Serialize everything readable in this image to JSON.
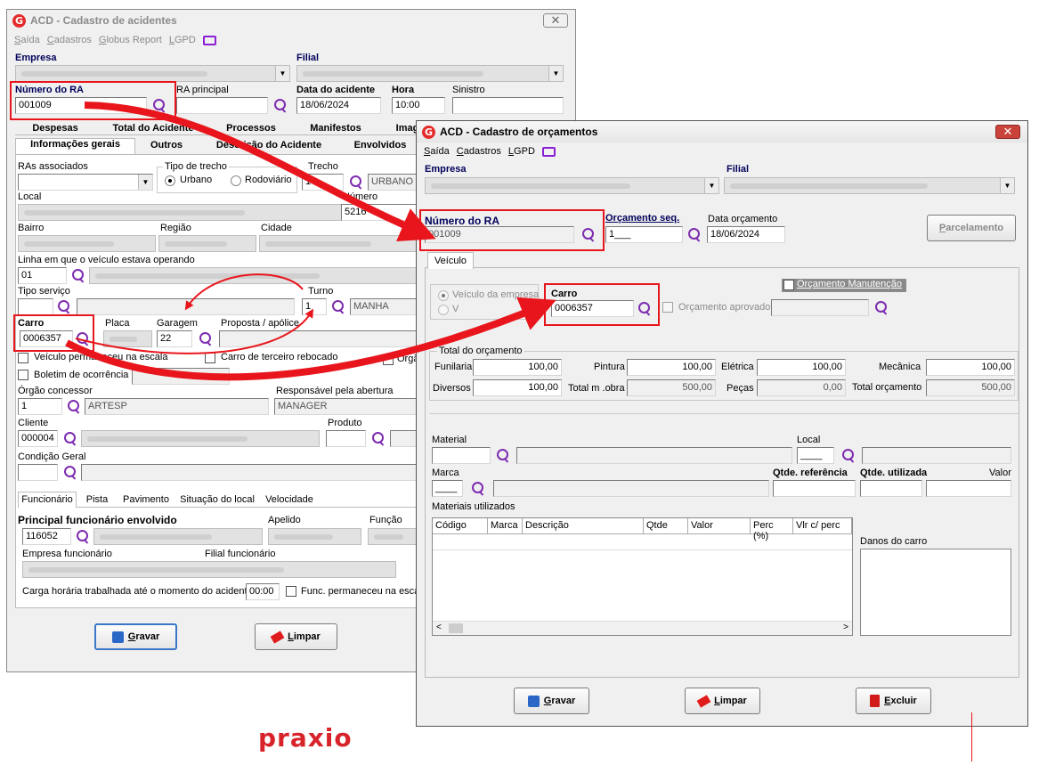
{
  "win1": {
    "title": "ACD - Cadastro de acidentes",
    "close": "✕",
    "menu": [
      "Saída",
      "Cadastros",
      "Globus Report",
      "LGPD"
    ],
    "empresa_label": "Empresa",
    "filial_label": "Filial",
    "numero_ra_label": "Número do RA",
    "numero_ra_value": "001009",
    "ra_principal_label": "RA principal",
    "data_acidente_label": "Data do acidente",
    "data_acidente_value": "18/06/2024",
    "hora_label": "Hora",
    "hora_value": "10:00",
    "sinistro_label": "Sinistro",
    "tabs_row1": [
      "Despesas",
      "Total do Acidente",
      "Processos",
      "Manifestos",
      "Imagens"
    ],
    "tabs_row2": [
      "Informações gerais",
      "Outros",
      "Descrição do Acidente",
      "Envolvidos"
    ],
    "ras_associados_label": "RAs associados",
    "tipo_trecho_label": "Tipo de trecho",
    "urbano": "Urbano",
    "rodoviario": "Rodoviário",
    "trecho_label": "Trecho",
    "trecho_value": "1",
    "trecho_desc": "URBANO",
    "local_label": "Local",
    "numero_label": "Número",
    "numero_value": "5216",
    "bairro_label": "Bairro",
    "regiao_label": "Região",
    "cidade_label": "Cidade",
    "linha_label": "Linha em que o veículo estava operando",
    "linha_value": "01",
    "tipo_servico_label": "Tipo serviço",
    "turno_label": "Turno",
    "turno_value": "1",
    "turno_desc": "MANHA",
    "carro_label": "Carro",
    "carro_value": "0006357",
    "placa_label": "Placa",
    "garagem_label": "Garagem",
    "garagem_value": "22",
    "proposta_label": "Proposta / apólice",
    "veiculo_permaneceu": "Veículo permaneceu na escala",
    "carro_terceiro": "Carro de terceiro rebocado",
    "org_cut": "Órgã",
    "boletim": "Boletim de ocorrência",
    "orgao_label": "Órgão concessor",
    "orgao_value": "1",
    "orgao_desc": "ARTESP",
    "responsavel_label": "Responsável pela abertura",
    "responsavel_value": "MANAGER",
    "cliente_label": "Cliente",
    "cliente_value": "000004",
    "produto_label": "Produto",
    "condicao_label": "Condição Geral",
    "subtabs": [
      "Funcionário",
      "Pista",
      "Pavimento",
      "Situação do local",
      "Velocidade"
    ],
    "principal_func_label": "Principal funcionário envolvido",
    "principal_func_value": "116052",
    "apelido_label": "Apelido",
    "funcao_label": "Função",
    "empresa_func_label": "Empresa funcionário",
    "filial_func_label": "Filial funcionário",
    "carga_label": "Carga horária trabalhada até o momento do acidente",
    "carga_value": "00:00",
    "func_permaneceu": "Func. permaneceu na escala",
    "gravar": "Gravar",
    "limpar": "Limpar"
  },
  "win2": {
    "title": "ACD - Cadastro de orçamentos",
    "close": "✕",
    "menu": [
      "Saída",
      "Cadastros",
      "LGPD"
    ],
    "empresa_label": "Empresa",
    "filial_label": "Filial",
    "numero_ra_label": "Número do RA",
    "numero_ra_value": "001009",
    "orcamento_seq_label": "Orçamento seq.",
    "orcamento_seq_value": "1___",
    "data_orcamento_label": "Data orçamento",
    "data_orcamento_value": "18/06/2024",
    "parcelamento": "Parcelamento",
    "tab_veiculo": "Veículo",
    "veiculo_da_empresa": "Veículo da empresa",
    "veiculo_cut": "V",
    "carro_label": "Carro",
    "carro_value": "0006357",
    "orcamento_manutencao": "Orçamento Manutenção",
    "orcamento_aprovado": "Orçamento aprovado",
    "total_group": "Total do orçamento",
    "totais": {
      "funilaria_label": "Funilaria",
      "funilaria": "100,00",
      "pintura_label": "Pintura",
      "pintura": "100,00",
      "eletrica_label": "Elétrica",
      "eletrica": "100,00",
      "mecanica_label": "Mecânica",
      "mecanica": "100,00",
      "diversos_label": "Diversos",
      "diversos": "100,00",
      "total_mobra_label": "Total m .obra",
      "total_mobra": "500,00",
      "pecas_label": "Peças",
      "pecas": "0,00",
      "total_orc_label": "Total orçamento",
      "total_orc": "500,00"
    },
    "material_label": "Material",
    "local_label": "Local",
    "local_value": "____",
    "marca_label": "Marca",
    "marca_value": "____",
    "qtde_ref_label": "Qtde. referência",
    "qtde_util_label": "Qtde. utilizada",
    "valor_label": "Valor",
    "materiais_label": "Materiais utilizados",
    "columns": [
      "Código",
      "Marca",
      "Descrição",
      "Qtde",
      "Valor",
      "Perc (%)",
      "Vlr c/ perc"
    ],
    "danos_label": "Danos do carro",
    "gravar": "Gravar",
    "limpar": "Limpar",
    "excluir": "Excluir"
  },
  "brand": "praxio",
  "colors": {
    "highlight": "#e8161c",
    "accent": "#7d2cb0",
    "label_blue": "#00005a"
  }
}
